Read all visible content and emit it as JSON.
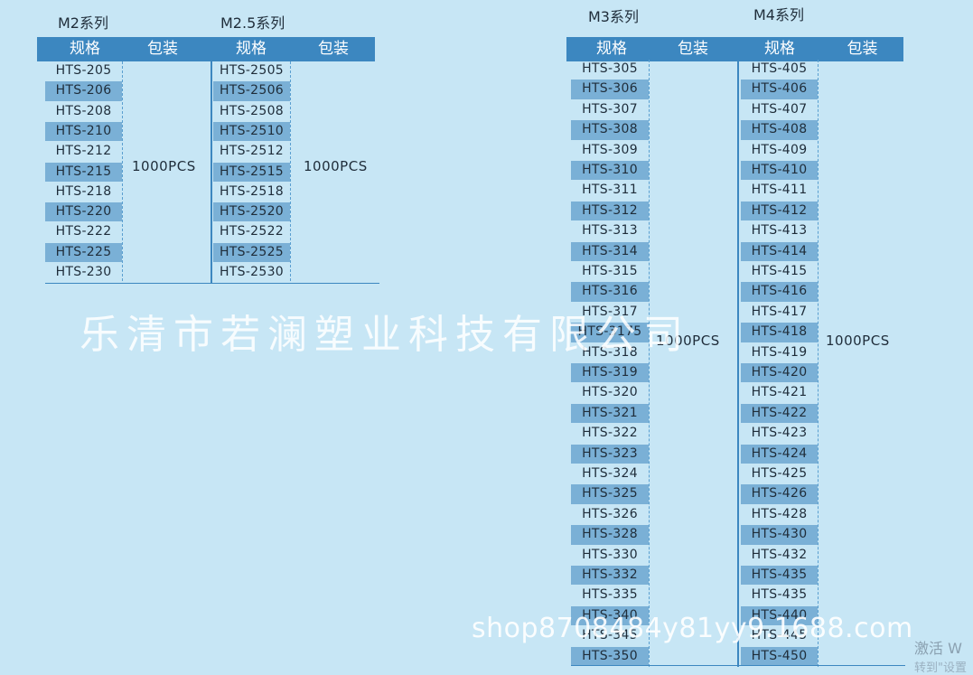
{
  "tables": [
    {
      "title": "M2系列",
      "header": {
        "spec": "规格",
        "pack": "包装"
      },
      "rows": [
        "HTS-205",
        "HTS-206",
        "HTS-208",
        "HTS-210",
        "HTS-212",
        "HTS-215",
        "HTS-218",
        "HTS-220",
        "HTS-222",
        "HTS-225",
        "HTS-230"
      ],
      "packing": "1000PCS"
    },
    {
      "title": "M2.5系列",
      "header": {
        "spec": "规格",
        "pack": "包装"
      },
      "rows": [
        "HTS-2505",
        "HTS-2506",
        "HTS-2508",
        "HTS-2510",
        "HTS-2512",
        "HTS-2515",
        "HTS-2518",
        "HTS-2520",
        "HTS-2522",
        "HTS-2525",
        "HTS-2530"
      ],
      "packing": "1000PCS"
    },
    {
      "title": "M3系列",
      "header": {
        "spec": "规格",
        "pack": "包装"
      },
      "rows": [
        "HTS-305",
        "HTS-306",
        "HTS-307",
        "HTS-308",
        "HTS-309",
        "HTS-310",
        "HTS-311",
        "HTS-312",
        "HTS-313",
        "HTS-314",
        "HTS-315",
        "HTS-316",
        "HTS-317",
        "HTS-3175",
        "HTS-318",
        "HTS-319",
        "HTS-320",
        "HTS-321",
        "HTS-322",
        "HTS-323",
        "HTS-324",
        "HTS-325",
        "HTS-326",
        "HTS-328",
        "HTS-330",
        "HTS-332",
        "HTS-335",
        "HTS-340",
        "HTS-345",
        "HTS-350"
      ],
      "packing": "1000PCS"
    },
    {
      "title": "M4系列",
      "header": {
        "spec": "规格",
        "pack": "包装"
      },
      "rows": [
        "HTS-405",
        "HTS-406",
        "HTS-407",
        "HTS-408",
        "HTS-409",
        "HTS-410",
        "HTS-411",
        "HTS-412",
        "HTS-413",
        "HTS-414",
        "HTS-415",
        "HTS-416",
        "HTS-417",
        "HTS-418",
        "HTS-419",
        "HTS-420",
        "HTS-421",
        "HTS-422",
        "HTS-423",
        "HTS-424",
        "HTS-425",
        "HTS-426",
        "HTS-428",
        "HTS-430",
        "HTS-432",
        "HTS-435",
        "HTS-435",
        "HTS-440",
        "HTS-445",
        "HTS-450"
      ],
      "packing": "1000PCS"
    }
  ],
  "watermark": {
    "company": "乐清市若澜塑业科技有限公司",
    "url": "shop8708484y81yy9.1688.com"
  },
  "system_notice": {
    "activate": "激活 W",
    "goto_settings": "转到\"设置"
  },
  "colors": {
    "background": "#c7e6f5",
    "header": "#3c87c0",
    "stripe": "#7ab0d6",
    "text": "#1f2d3a"
  }
}
